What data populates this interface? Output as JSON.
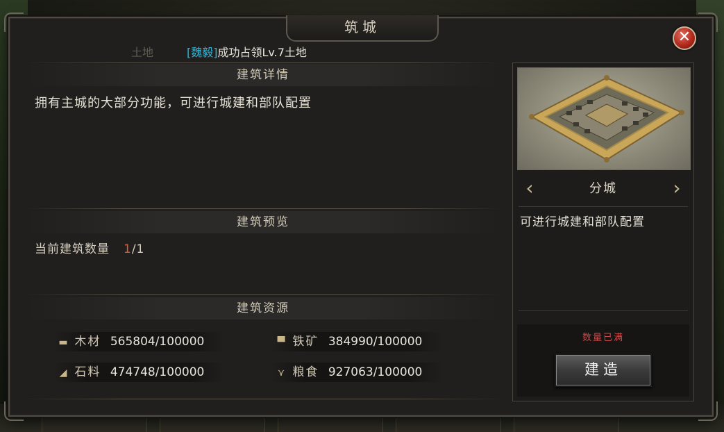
{
  "window": {
    "title": "筑城",
    "close_label": "✕"
  },
  "notice": {
    "faded_text": "土地",
    "tag": "[魏毅]",
    "message": "成功占领Lv.7土地"
  },
  "details": {
    "heading": "建筑详情",
    "description": "拥有主城的大部分功能，可进行城建和部队配置"
  },
  "preview_section": {
    "heading": "建筑预览",
    "count_label": "当前建筑数量",
    "count_current": "1",
    "count_total": "/1"
  },
  "resources": {
    "heading": "建筑资源",
    "items": [
      {
        "name": "木材",
        "value": "565804/100000",
        "icon": "wood-icon"
      },
      {
        "name": "铁矿",
        "value": "384990/100000",
        "icon": "iron-icon"
      },
      {
        "name": "石料",
        "value": "474748/100000",
        "icon": "stone-icon"
      },
      {
        "name": "粮食",
        "value": "927063/100000",
        "icon": "grain-icon"
      }
    ]
  },
  "building": {
    "name": "分城",
    "description": "可进行城建和部队配置",
    "prev_arrow": "‹",
    "next_arrow": "›",
    "status": "数量已满",
    "build_label": "建造"
  }
}
